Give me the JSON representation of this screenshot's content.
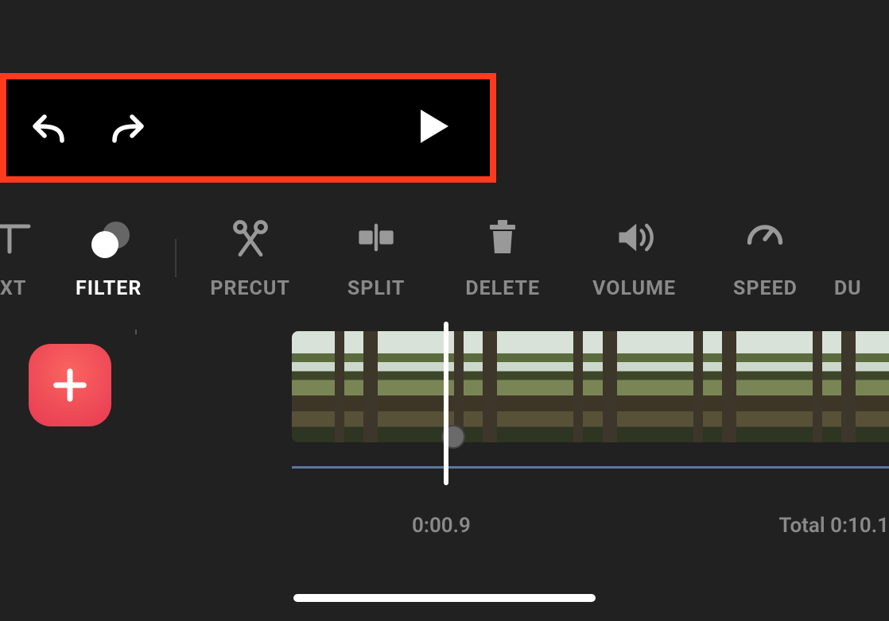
{
  "controls": {
    "undo": "undo",
    "redo": "redo",
    "play": "play"
  },
  "toolbar": {
    "items": [
      {
        "id": "text",
        "label": "XT",
        "partial": "left"
      },
      {
        "id": "filter",
        "label": "FILTER",
        "active": true
      },
      {
        "id": "precut",
        "label": "PRECUT"
      },
      {
        "id": "split",
        "label": "SPLIT"
      },
      {
        "id": "delete",
        "label": "DELETE"
      },
      {
        "id": "volume",
        "label": "VOLUME"
      },
      {
        "id": "speed",
        "label": "SPEED"
      },
      {
        "id": "duplicate",
        "label": "DU",
        "partial": "right"
      }
    ]
  },
  "timeline": {
    "current_time": "0:00.9",
    "total_label": "Total 0:10.1",
    "frame_count": 5,
    "add_label": "add"
  },
  "colors": {
    "highlight_border": "#ff3b1f",
    "add_button": "#ee4a57",
    "track": "#5877a3"
  }
}
